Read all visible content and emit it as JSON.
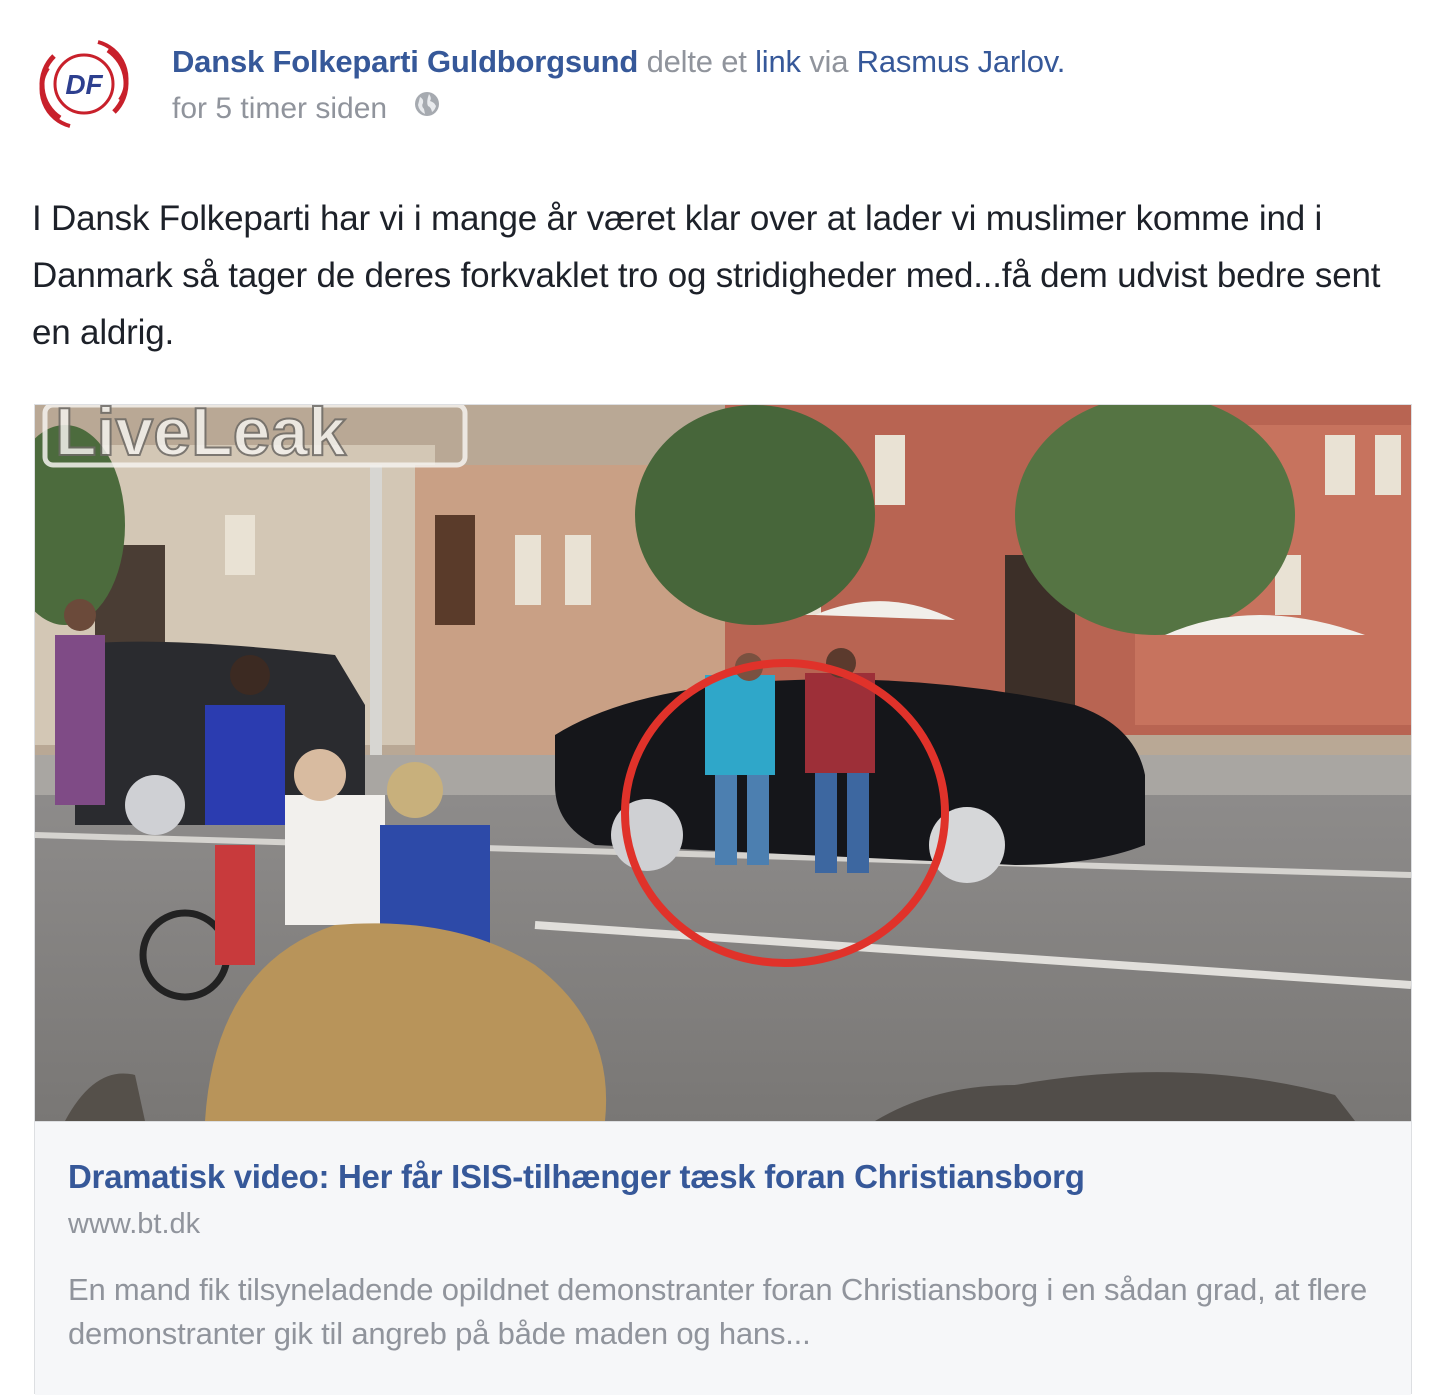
{
  "post": {
    "page_name": "Dansk Folkeparti Guldborgsund",
    "action_text": "delte et",
    "link_word": "link",
    "via_text": "via",
    "via_name": "Rasmus Jarlov.",
    "timestamp": "for 5 timer siden",
    "privacy_icon": "globe-icon",
    "avatar_text": "DF",
    "text": "I Dansk Folkeparti har vi i mange år været klar over at lader vi muslimer komme ind i Danmark så tager de deres forkvaklet tro og stridigheder med...få dem udvist bedre sent en aldrig."
  },
  "link_preview": {
    "watermark": "LiveLeak",
    "title": "Dramatisk video: Her får ISIS-tilhænger tæsk foran Christiansborg",
    "domain": "www.bt.dk",
    "description": "En mand fik tilsyneladende opildnet demonstranter foran Christiansborg i en sådan grad, at flere demonstranter gik til angreb på både maden og hans..."
  },
  "colors": {
    "link_blue": "#365899",
    "meta_grey": "#90949c",
    "text_dark": "#1d2129",
    "card_bg": "#f6f7f9",
    "highlight_red": "#e0322a",
    "logo_red": "#c8202b"
  }
}
